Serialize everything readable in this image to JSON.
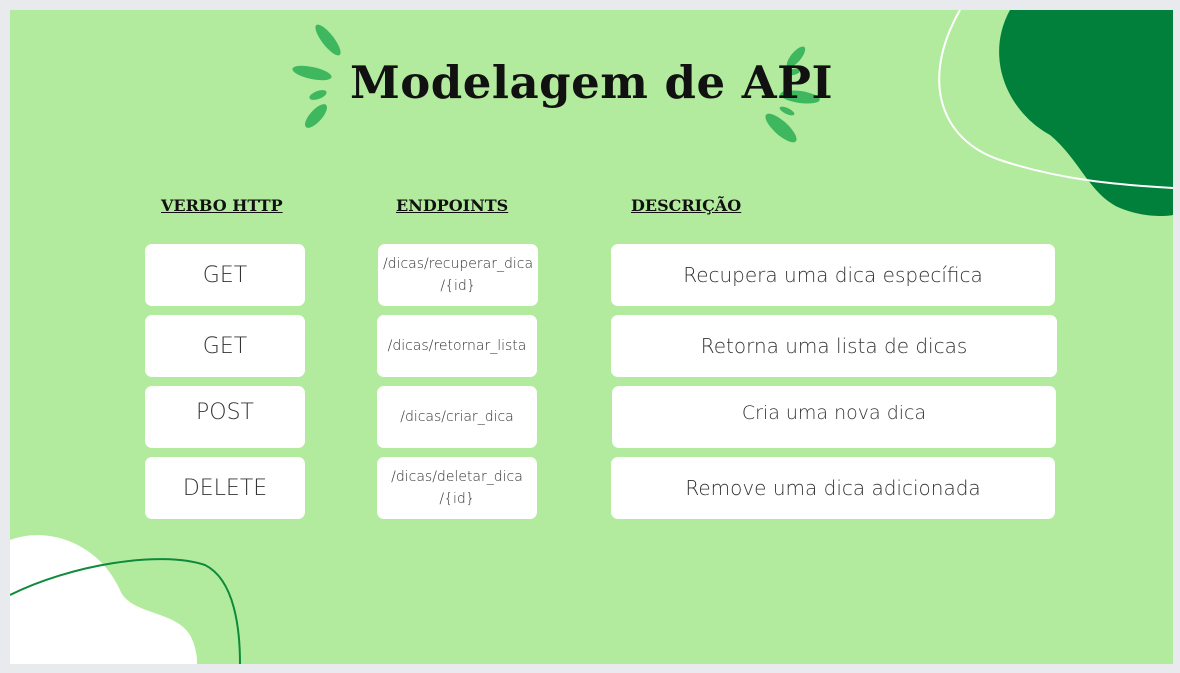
{
  "slide": {
    "title": "Modelagem de API",
    "headers": {
      "verb": "VERBO HTTP",
      "endpoint": "ENDPOINTS",
      "description": "DESCRIÇÃO"
    },
    "rows": [
      {
        "verb": "GET",
        "endpoint": "/dicas/recuperar_dica /{id}",
        "description": "Recupera uma dica específica"
      },
      {
        "verb": "GET",
        "endpoint": "/dicas/retornar_lista",
        "description": "Retorna uma lista de dicas"
      },
      {
        "verb": "POST",
        "endpoint": "/dicas/criar_dica",
        "description": "Cria uma nova dica"
      },
      {
        "verb": "DELETE",
        "endpoint": "/dicas/deletar_dica /{id}",
        "description": "Remove uma dica adicionada"
      }
    ]
  },
  "colors": {
    "background": "#b3eb9e",
    "accent_dark_green": "#00803a",
    "accent_green": "#3fb75e",
    "card": "#ffffff"
  },
  "icons": [
    "sparkle-left-icon",
    "sparkle-right-icon"
  ]
}
